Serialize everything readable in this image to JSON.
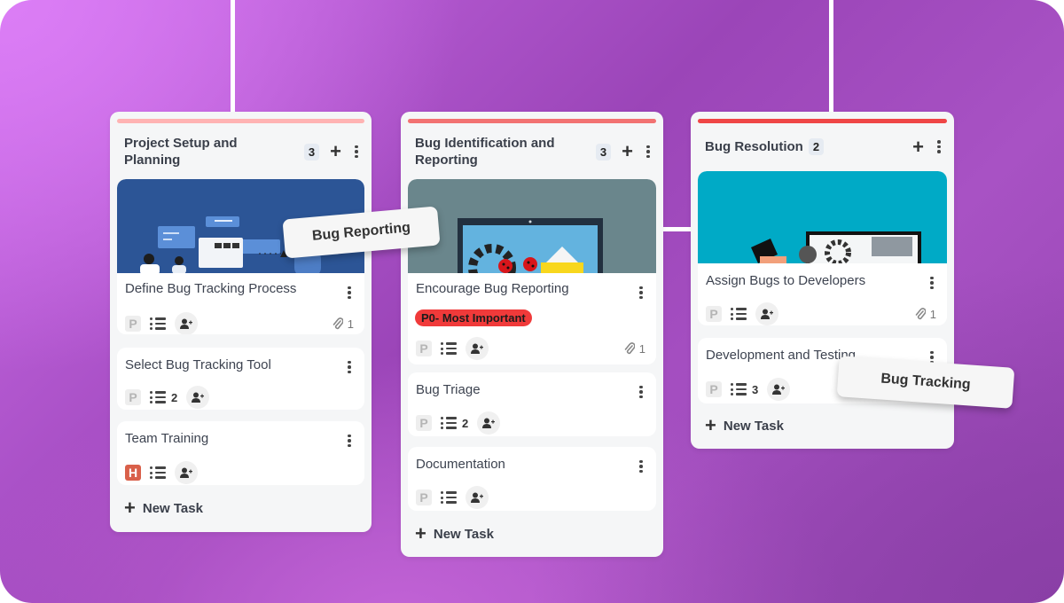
{
  "colors": {
    "col1_bar": "#ffb3b3",
    "col2_bar": "#f27272",
    "col3_bar": "#ef4646",
    "priority_tag": "#f03a3a",
    "high_priority": "#d9604a",
    "img1_bg": "#2c5596",
    "img2_bg": "#6a868c",
    "img3_bg": "#00aac6"
  },
  "icons": {
    "add": "plus-icon",
    "more": "kebab-icon",
    "subtasks": "list-icon",
    "assign": "add-user-icon",
    "attachment": "paperclip-icon"
  },
  "columns": [
    {
      "title_line1": "Project Setup and",
      "title_line2": "Planning",
      "count": "3",
      "tasks": [
        {
          "title": "Define Bug Tracking Process",
          "priority": "P",
          "subtasks": "",
          "attachments": "1"
        },
        {
          "title": "Select Bug Tracking Tool",
          "priority": "P",
          "subtasks": "2",
          "attachments": ""
        },
        {
          "title": "Team Training",
          "priority": "H",
          "subtasks": "",
          "attachments": ""
        }
      ],
      "new_task_label": "New Task"
    },
    {
      "title_line1": "Bug Identification and",
      "title_line2": "Reporting",
      "count": "3",
      "tasks": [
        {
          "title": "Encourage Bug Reporting",
          "tag": "P0- Most Important",
          "priority": "P",
          "subtasks": "",
          "attachments": "1"
        },
        {
          "title": "Bug Triage",
          "priority": "P",
          "subtasks": "2",
          "attachments": ""
        },
        {
          "title": "Documentation",
          "priority": "P",
          "subtasks": "",
          "attachments": ""
        }
      ],
      "new_task_label": "New Task"
    },
    {
      "title_line1": "Bug Resolution",
      "count": "2",
      "tasks": [
        {
          "title": "Assign Bugs to Developers",
          "priority": "P",
          "subtasks": "",
          "attachments": "1"
        },
        {
          "title": "Development and Testing",
          "priority": "P",
          "subtasks": "3",
          "attachments": ""
        }
      ],
      "new_task_label": "New Task"
    }
  ],
  "floating_tags": {
    "reporting": "Bug Reporting",
    "tracking": "Bug Tracking"
  }
}
